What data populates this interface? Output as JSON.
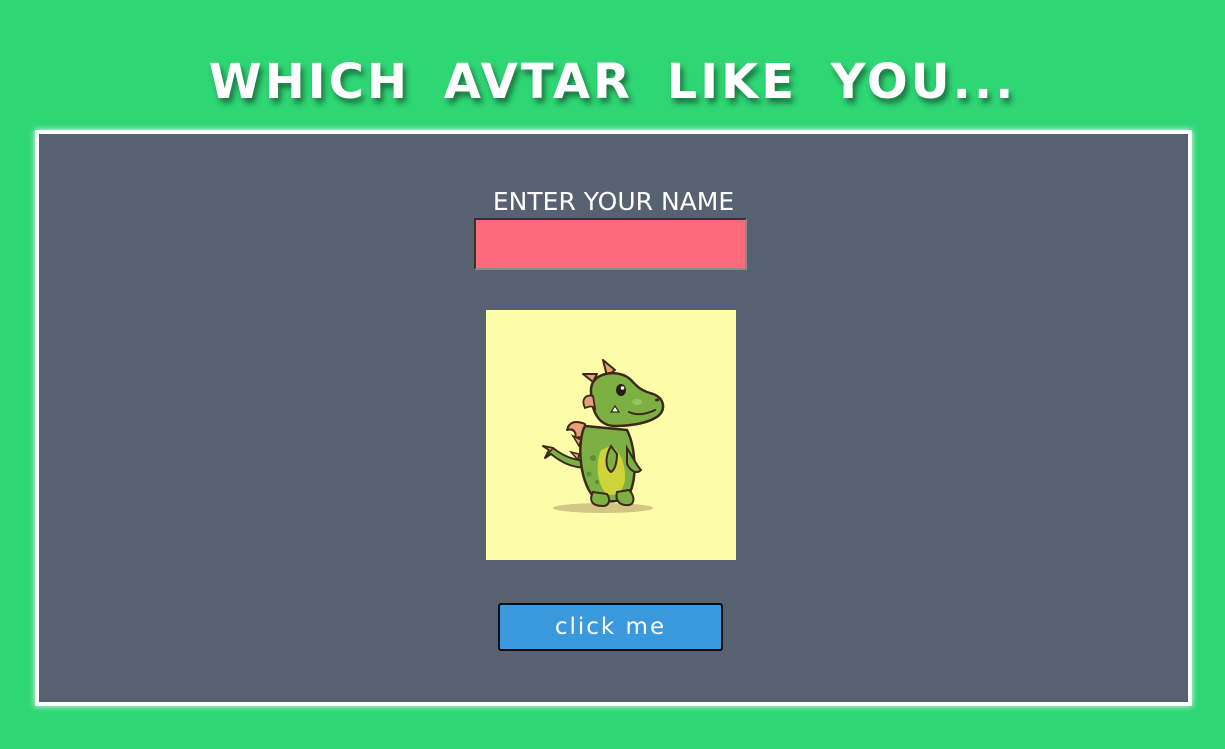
{
  "header": {
    "title": "WHICH AVTAR LIKE YOU..."
  },
  "form": {
    "name_label": "ENTER YOUR NAME",
    "name_value": "",
    "name_placeholder": ""
  },
  "avatar": {
    "icon": "dragon-avatar-icon",
    "background_color": "#fdfca9"
  },
  "actions": {
    "click_label": "click me"
  },
  "colors": {
    "page_background": "#2fd674",
    "panel_background": "#576171",
    "input_background": "#ff6b7d",
    "button_background": "#3a99dd"
  }
}
